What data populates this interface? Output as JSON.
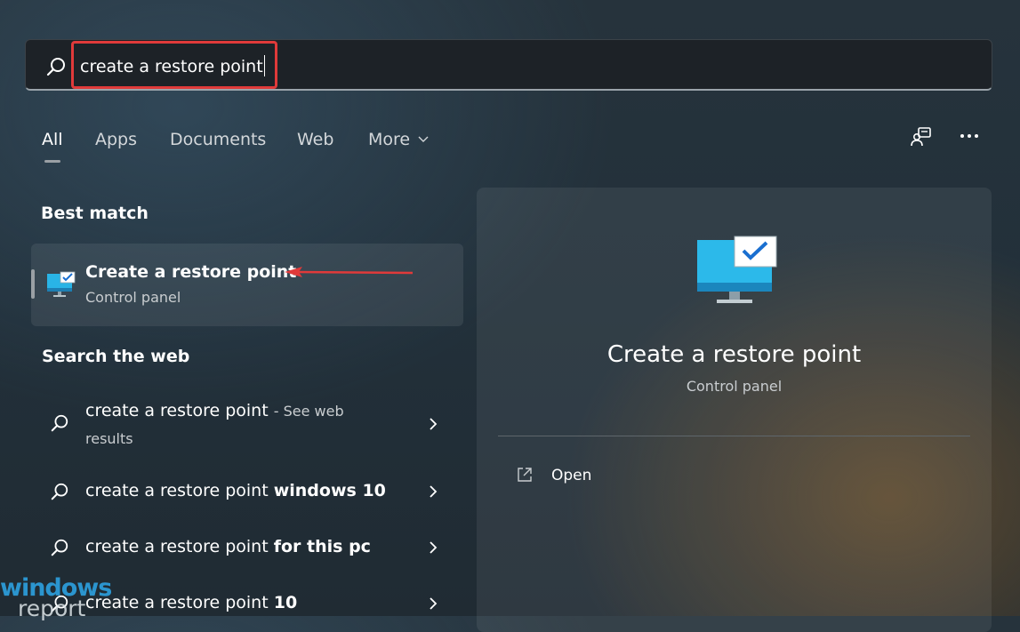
{
  "search": {
    "value": "create a restore point"
  },
  "tabs": [
    {
      "label": "All"
    },
    {
      "label": "Apps"
    },
    {
      "label": "Documents"
    },
    {
      "label": "Web"
    },
    {
      "label": "More"
    }
  ],
  "sections": {
    "best_match": "Best match",
    "search_web": "Search the web"
  },
  "best_match": {
    "title": "Create a restore point",
    "subtitle": "Control panel"
  },
  "web_results": [
    {
      "prefix": "create a restore point",
      "suffix": "",
      "note": "- See web",
      "note2": "results"
    },
    {
      "prefix": "create a restore point ",
      "suffix": "windows 10"
    },
    {
      "prefix": "create a restore point ",
      "suffix": "for this pc"
    },
    {
      "prefix": "create a restore point ",
      "suffix": "10"
    }
  ],
  "detail": {
    "title": "Create a restore point",
    "subtitle": "Control panel",
    "open_label": "Open"
  },
  "icons": {
    "search": "search-icon",
    "feedback": "feedback-icon",
    "more": "more-options-icon",
    "app": "restore-point-monitor-icon",
    "open": "open-external-icon",
    "chevron": "chevron-right-icon"
  },
  "watermark": {
    "line1": "windows",
    "line2": "report"
  },
  "colors": {
    "highlight": "#e03a3a",
    "accent_blue": "#2da1e0"
  }
}
